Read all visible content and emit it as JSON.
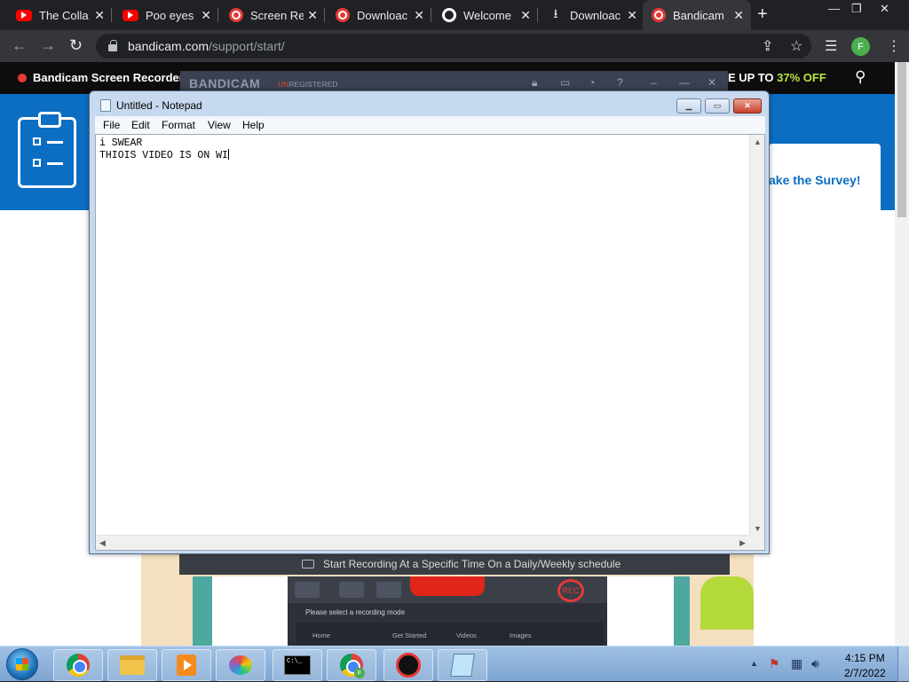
{
  "browser": {
    "tabs": [
      {
        "label": "The Colla",
        "icon": "youtube-icon"
      },
      {
        "label": "Poo eyes",
        "icon": "youtube-icon"
      },
      {
        "label": "Screen Re",
        "icon": "bandicam-record-icon"
      },
      {
        "label": "Downloac",
        "icon": "bandicam-record-icon"
      },
      {
        "label": "Welcome",
        "icon": "globe-icon"
      },
      {
        "label": "Downloac",
        "icon": "download-icon"
      },
      {
        "label": "Bandicam",
        "icon": "bandicam-record-icon",
        "active": true
      }
    ],
    "new_tab_label": "+",
    "url_host": "bandicam.com",
    "url_path": "/support/start/",
    "profile_initial": "F"
  },
  "site": {
    "brand": "Bandicam Screen Recorder",
    "promo_prefix": "E UP TO ",
    "promo_pct": "37% OFF",
    "survey_label": "ake the Survey!",
    "promo_strip_text": "Start Recording At a Specific Time On a Daily/Weekly schedule",
    "mini_app": {
      "hint": "Please select a recording mode",
      "nav": [
        "Home",
        "Get Started",
        "Videos",
        "Images"
      ],
      "rec_label": "REC"
    }
  },
  "bandicam_overlay": {
    "logo": "BANDICAM",
    "unregistered_prefix": "UN",
    "unregistered_rest": "REGISTERED"
  },
  "notepad": {
    "title": "Untitled - Notepad",
    "menus": [
      "File",
      "Edit",
      "Format",
      "View",
      "Help"
    ],
    "line1": "i SWEAR",
    "line2": "THIOIS VIDEO IS ON WI"
  },
  "taskbar": {
    "clock_time": "4:15 PM",
    "clock_date": "2/7/2022",
    "cmd_prompt": "C:\\_",
    "chrome_profile_badge": "F"
  },
  "colors": {
    "site_blue": "#0b6ec3",
    "promo_green": "#b6e340",
    "record_red": "#e53935"
  }
}
